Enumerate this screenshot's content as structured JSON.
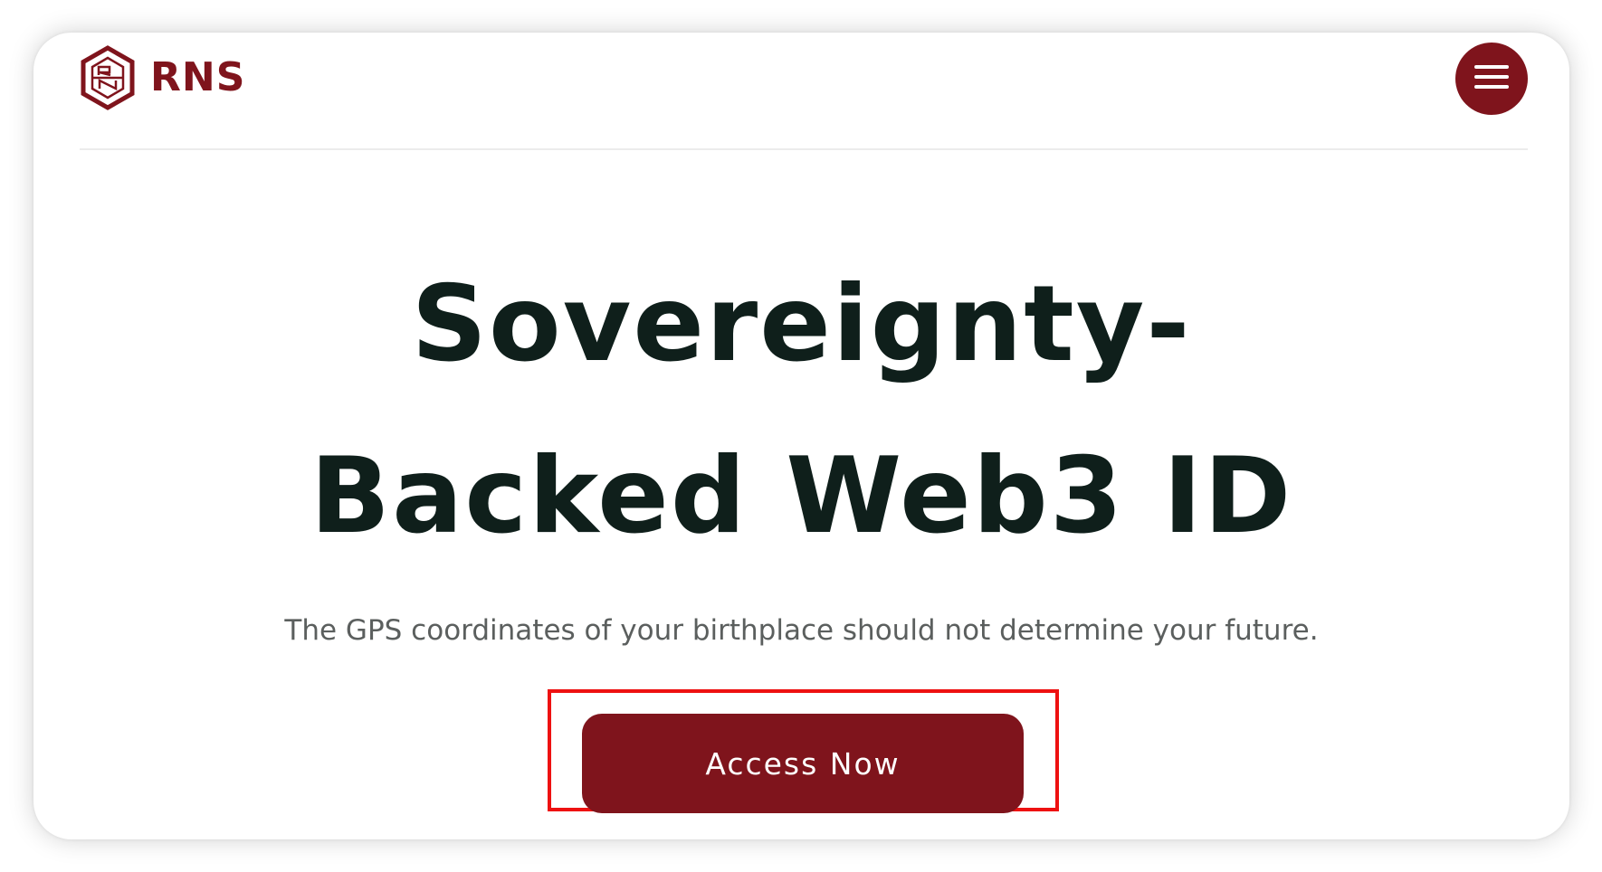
{
  "brand": {
    "name": "RNS",
    "logo_icon": "rns-hexagon-logo-icon",
    "color": "#7f141c"
  },
  "header": {
    "menu_icon": "hamburger-menu-icon"
  },
  "hero": {
    "title_line1": "Sovereignty-",
    "title_line2": "Backed Web3 ID",
    "subtitle": "The GPS coordinates of your birthplace should not determine your future.",
    "cta_label": "Access Now"
  },
  "colors": {
    "accent": "#7f141c",
    "title": "#0f1f1b",
    "subtitle": "#5b5f5e",
    "highlight": "#ee1111"
  }
}
